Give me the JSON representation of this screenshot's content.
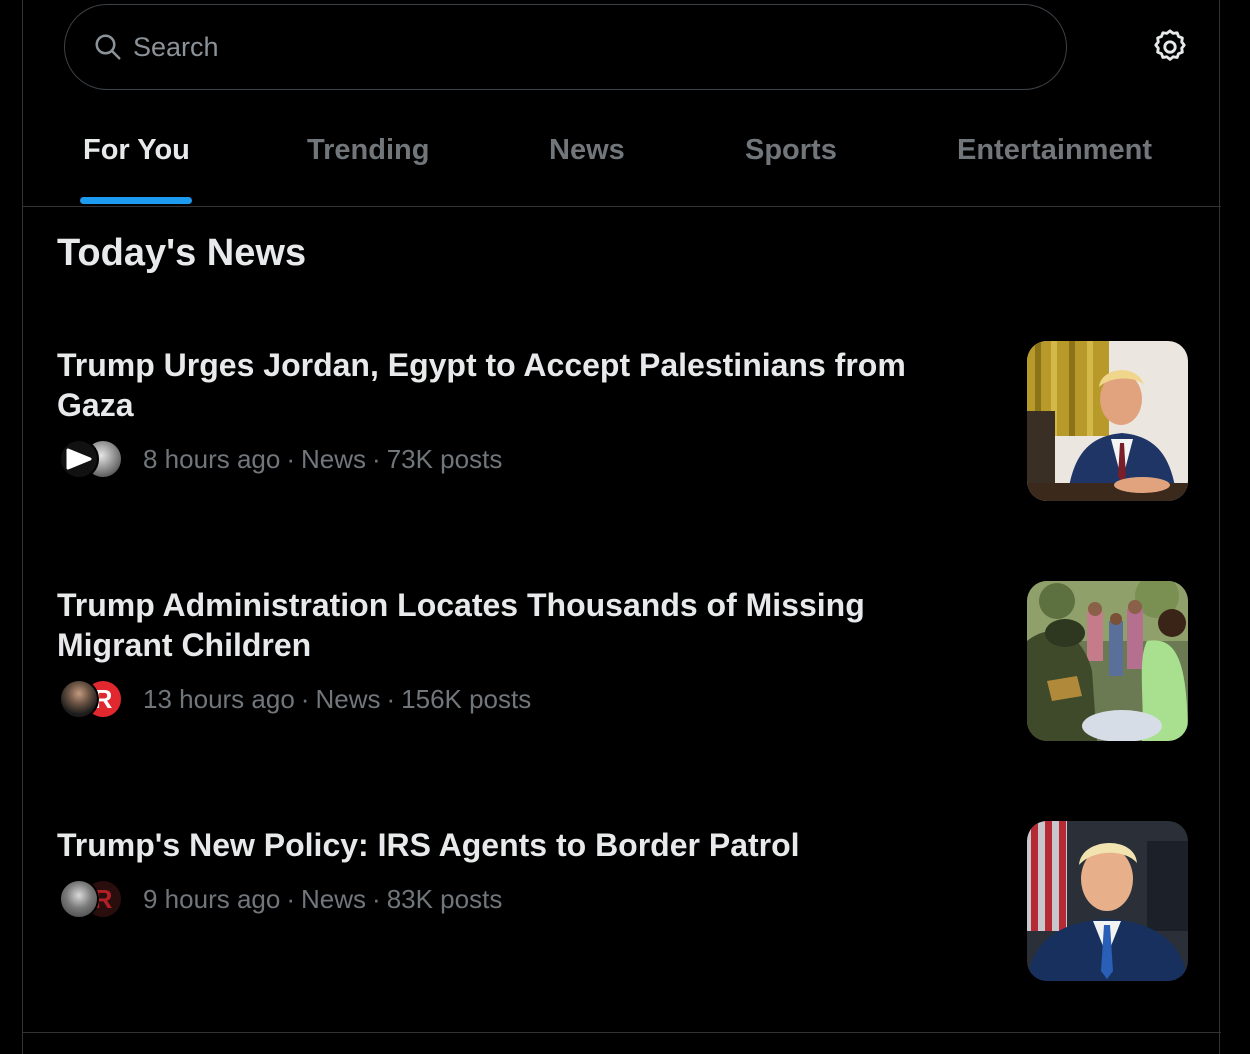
{
  "search": {
    "placeholder": "Search"
  },
  "tabs": [
    {
      "label": "For You",
      "active": true
    },
    {
      "label": "Trending",
      "active": false
    },
    {
      "label": "News",
      "active": false
    },
    {
      "label": "Sports",
      "active": false
    },
    {
      "label": "Entertainment",
      "active": false
    }
  ],
  "section": {
    "title": "Today's News"
  },
  "news": [
    {
      "headline": "Trump Urges Jordan, Egypt to Accept Palestinians from Gaza",
      "time": "8 hours ago",
      "category": "News",
      "posts": "73K posts"
    },
    {
      "headline": "Trump Administration Locates Thousands of Missing Migrant Children",
      "time": "13 hours ago",
      "category": "News",
      "posts": "156K posts"
    },
    {
      "headline": "Trump's New Policy: IRS Agents to Border Patrol",
      "time": "9 hours ago",
      "category": "News",
      "posts": "83K posts"
    }
  ],
  "colors": {
    "accent": "#1d9bf0",
    "background": "#000000",
    "text_primary": "#e7e9ea",
    "text_secondary": "#71767b",
    "divider": "#2f3336"
  },
  "icons": [
    "search-icon",
    "settings-gear-icon"
  ]
}
